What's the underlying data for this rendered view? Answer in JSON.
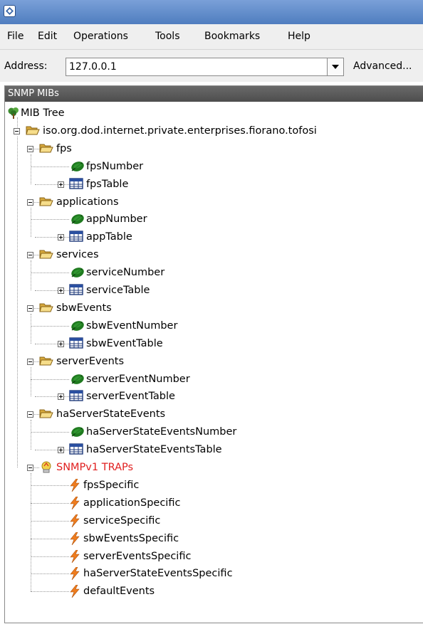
{
  "menu": [
    "File",
    "Edit",
    "Operations",
    "Tools",
    "Bookmarks",
    "Help"
  ],
  "address": {
    "label": "Address:",
    "value": "127.0.0.1",
    "advanced_label": "Advanced..."
  },
  "panel": {
    "title": "SNMP MIBs"
  },
  "tree": [
    {
      "label": "MIB Tree",
      "icon": "tree-icon",
      "depth": 0
    },
    {
      "label": "iso.org.dod.internet.private.enterprises.fiorano.tofosi",
      "icon": "folder-open-icon",
      "depth": 1,
      "toggle": "minus"
    },
    {
      "label": "fps",
      "icon": "folder-open-icon",
      "depth": 2,
      "toggle": "minus"
    },
    {
      "label": "fpsNumber",
      "icon": "leaf-icon",
      "depth": 3
    },
    {
      "label": "fpsTable",
      "icon": "table-icon",
      "depth": 3,
      "toggle": "plus"
    },
    {
      "label": "applications",
      "icon": "folder-open-icon",
      "depth": 2,
      "toggle": "minus"
    },
    {
      "label": "appNumber",
      "icon": "leaf-icon",
      "depth": 3
    },
    {
      "label": "appTable",
      "icon": "table-icon",
      "depth": 3,
      "toggle": "plus"
    },
    {
      "label": "services",
      "icon": "folder-open-icon",
      "depth": 2,
      "toggle": "minus"
    },
    {
      "label": "serviceNumber",
      "icon": "leaf-icon",
      "depth": 3
    },
    {
      "label": "serviceTable",
      "icon": "table-icon",
      "depth": 3,
      "toggle": "plus"
    },
    {
      "label": "sbwEvents",
      "icon": "folder-open-icon",
      "depth": 2,
      "toggle": "minus"
    },
    {
      "label": "sbwEventNumber",
      "icon": "leaf-icon",
      "depth": 3
    },
    {
      "label": "sbwEventTable",
      "icon": "table-icon",
      "depth": 3,
      "toggle": "plus"
    },
    {
      "label": "serverEvents",
      "icon": "folder-open-icon",
      "depth": 2,
      "toggle": "minus"
    },
    {
      "label": "serverEventNumber",
      "icon": "leaf-icon",
      "depth": 3
    },
    {
      "label": "serverEventTable",
      "icon": "table-icon",
      "depth": 3,
      "toggle": "plus"
    },
    {
      "label": "haServerStateEvents",
      "icon": "folder-open-icon",
      "depth": 2,
      "toggle": "minus"
    },
    {
      "label": "haServerStateEventsNumber",
      "icon": "leaf-icon",
      "depth": 3
    },
    {
      "label": "haServerStateEventsTable",
      "icon": "table-icon",
      "depth": 3,
      "toggle": "plus"
    },
    {
      "label": "SNMPv1 TRAPs",
      "icon": "trap-group-icon",
      "depth": 2,
      "toggle": "minus",
      "color": "#e01f1f"
    },
    {
      "label": "fpsSpecific",
      "icon": "lightning-icon",
      "depth": 3
    },
    {
      "label": "applicationSpecific",
      "icon": "lightning-icon",
      "depth": 3
    },
    {
      "label": "serviceSpecific",
      "icon": "lightning-icon",
      "depth": 3
    },
    {
      "label": "sbwEventsSpecific",
      "icon": "lightning-icon",
      "depth": 3
    },
    {
      "label": "serverEventsSpecific",
      "icon": "lightning-icon",
      "depth": 3
    },
    {
      "label": "haServerStateEventsSpecific",
      "icon": "lightning-icon",
      "depth": 3
    },
    {
      "label": "defaultEvents",
      "icon": "lightning-icon",
      "depth": 3
    }
  ]
}
